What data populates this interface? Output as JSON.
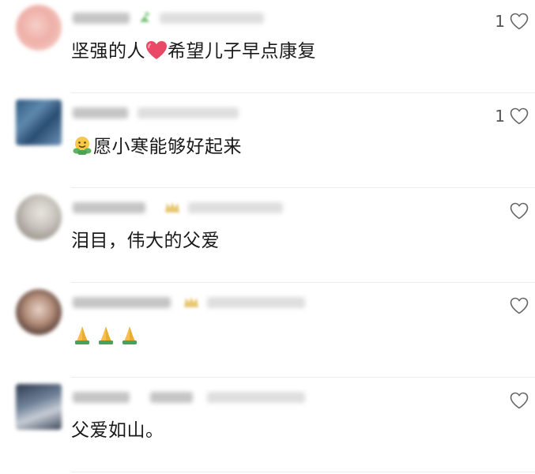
{
  "comments": [
    {
      "text_before": "坚强的人",
      "text_after": "希望儿子早点康复",
      "inline_emoji": "red-heart",
      "likes": "1",
      "avatar_color": "#f1b9b2"
    },
    {
      "emoji": "hugging-face",
      "text": "愿小寒能够好起来",
      "likes": "1",
      "avatar_color": "#3f6d95"
    },
    {
      "text": "泪目，伟大的父爱",
      "likes": "",
      "avatar_color": "#b9b4ad"
    },
    {
      "emoji": "folded-hands x3",
      "text": "",
      "likes": "",
      "avatar_color": "#a38c80"
    },
    {
      "text": "父爱如山。",
      "likes": "",
      "avatar_color": "#5b6f8a"
    }
  ],
  "colors": {
    "text": "#1a1a1a",
    "meta_blur": "#c9c9c9",
    "like_icon": "#666666",
    "divider": "#ececec",
    "heart": "#e94867"
  }
}
